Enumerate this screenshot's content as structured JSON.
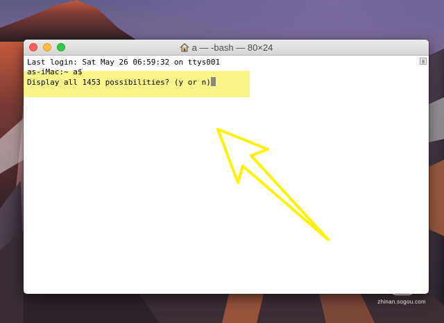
{
  "window": {
    "title": "a — -bash — 80×24",
    "title_icon": "home-icon"
  },
  "terminal": {
    "lines": [
      "Last login: Sat May 26 06:59:32 on ttys001",
      "as-iMac:~ a$",
      "Display all 1453 possibilities? (y or n)"
    ]
  },
  "watermark": {
    "text": "zhinan.sogou.com"
  },
  "colors": {
    "highlight": "#fbf58a",
    "arrow": "#fff200",
    "close": "#fc605c",
    "minimize": "#fdbc40",
    "maximize": "#34c84a"
  }
}
